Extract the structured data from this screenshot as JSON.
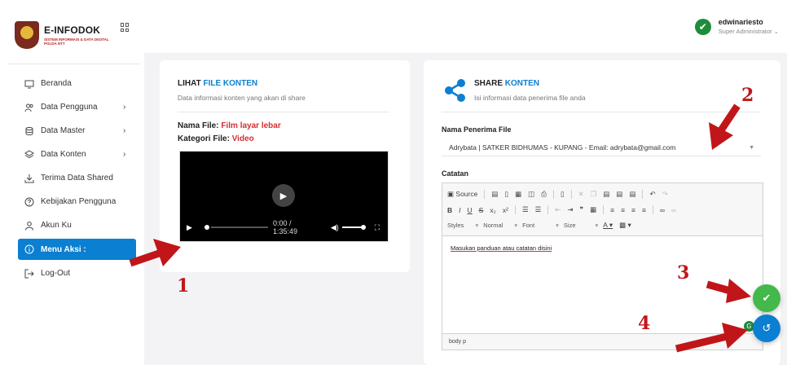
{
  "app": {
    "brand": "E-INFODOK",
    "brand_sub": "SISTEM INFORMASI & DATA DIGITAL POLDA NTT"
  },
  "sidebar": {
    "items": [
      {
        "label": "Beranda",
        "icon": "monitor-icon",
        "chevron": ""
      },
      {
        "label": "Data Pengguna",
        "icon": "users-icon",
        "chevron": "›"
      },
      {
        "label": "Data Master",
        "icon": "database-icon",
        "chevron": "›"
      },
      {
        "label": "Data Konten",
        "icon": "layers-icon",
        "chevron": "›"
      },
      {
        "label": "Terima Data Shared",
        "icon": "download-icon",
        "chevron": ""
      },
      {
        "label": "Kebijakan Pengguna",
        "icon": "help-circle-icon",
        "chevron": ""
      },
      {
        "label": "Akun Ku",
        "icon": "user-icon",
        "chevron": ""
      },
      {
        "label": "Menu Aksi :",
        "icon": "info-icon",
        "chevron": "",
        "active": true
      },
      {
        "label": "Log-Out",
        "icon": "logout-icon",
        "chevron": ""
      }
    ]
  },
  "header": {
    "username": "edwinariesto",
    "role": "Super Administrator ⌄"
  },
  "left_card": {
    "title_prefix": "LIHAT ",
    "title_accent": "FILE KONTEN",
    "subtitle": "Data informasi konten yang akan di share",
    "filename_label": "Nama File: ",
    "filename_value": "Film layar lebar",
    "category_label": "Kategori File: ",
    "category_value": "Video",
    "video": {
      "time": "0:00 / 1:35:49"
    }
  },
  "right_card": {
    "title_prefix": "SHARE ",
    "title_accent": "KONTEN",
    "subtitle": "Isi informasi data penerima file anda",
    "recipient_label": "Nama Penerima File",
    "recipient_value": "Adrybata | SATKER BIDHUMAS - KUPANG - Email: adrybata@gmail.com",
    "notes_label": "Catatan",
    "editor": {
      "source_label": "Source",
      "styles_label": "Styles",
      "format_label": "Normal",
      "font_label": "Font",
      "size_label": "Size",
      "content": "Masukan panduan atau catatan disini",
      "status_path": "body  p"
    }
  },
  "annotations": [
    "1",
    "2",
    "3",
    "4"
  ],
  "colors": {
    "accent": "#0b7fd1",
    "red": "#d32f2f",
    "success": "#43b84b",
    "annotation": "#c0161a"
  }
}
